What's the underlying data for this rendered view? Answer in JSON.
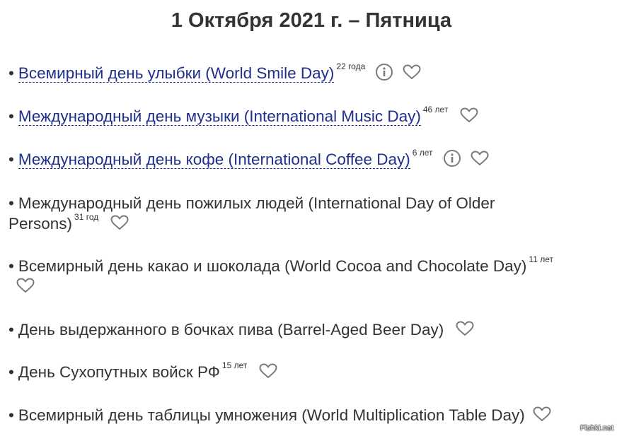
{
  "title": "1 Октября 2021 г. – Пятница",
  "bullet": "•",
  "holidays": [
    {
      "label": "Всемирный день улыбки (World Smile Day)",
      "years": "22 года",
      "link": true,
      "info": true
    },
    {
      "label": "Международный день музыки (International Music Day)",
      "years": "46 лет",
      "link": true,
      "info": false
    },
    {
      "label": "Международный день кофе (International Coffee Day)",
      "years": "6 лет",
      "link": true,
      "info": true
    },
    {
      "label": "Международный день пожилых людей (International Day of Older Persons)",
      "years": "31 год",
      "link": false,
      "info": false
    },
    {
      "label": "Всемирный день какао и шоколада (World Cocoa and Chocolate Day)",
      "years": "11 лет",
      "link": false,
      "info": false
    },
    {
      "label": "День выдержанного в бочках пива (Barrel-Aged Beer Day)",
      "years": "",
      "link": false,
      "info": false
    },
    {
      "label": "День Сухопутных войск РФ",
      "years": "15 лет",
      "link": false,
      "info": false
    },
    {
      "label": "Всемирный день таблицы умножения (World Multiplication Table Day)",
      "years": "",
      "link": false,
      "info": false
    }
  ],
  "icons": {
    "info": "info-icon",
    "favorite": "heart-icon"
  },
  "colors": {
    "text": "#333333",
    "link": "#1e2f8c",
    "icon": "#7a7a7a"
  },
  "watermark": "Fishki.net"
}
